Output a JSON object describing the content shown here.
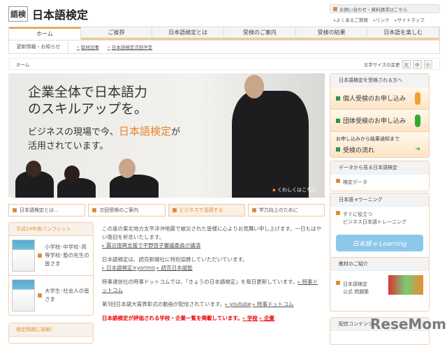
{
  "header": {
    "logo_mark": "語検",
    "title": "日本語検定",
    "contact": "お問い合わせ・資料請求はこちら",
    "links": [
      "よくあるご質問",
      "リンク",
      "サイトマップ"
    ]
  },
  "nav": {
    "tabs": [
      "ホーム",
      "ご挨拶",
      "日本語検定とは",
      "受検のご案内",
      "受検の結果",
      "日本語を楽しむ"
    ],
    "sub_label": "更新情報・お知らせ",
    "sub_links": [
      "取材記事",
      "日本語検定次回予定"
    ]
  },
  "breadcrumb": {
    "current": "ホーム",
    "font_size_label": "文字サイズの変更",
    "sizes": [
      "大",
      "中",
      "小"
    ]
  },
  "hero": {
    "line1": "企業全体で日本語力",
    "line2": "のスキルアップを。",
    "line3a": "ビジネスの現場で今、",
    "line3b": "日本語検定",
    "line3c": "が",
    "line4": "活用されています。",
    "more": "くわしくはこちら"
  },
  "subbuttons": [
    "日本語検定とは…",
    "次回受検のご案内",
    "ビジネスで活用する",
    "学力向上のために"
  ],
  "left": {
    "pamphlet_title": "平成24年度パンフレット",
    "items": [
      "小学校･中学校･高等学校･塾の先生の皆さま",
      "大学生･社会人の皆さま"
    ],
    "challenge_title": "検定問題に挑戦！"
  },
  "main": {
    "p1": "この度の東北地方太平洋沖地震で被災された皆様に心よりお見舞い申し上げます。一日もはやい復旧を祈念いたします。",
    "p1_link": "震災復興支援で平野啓子審議委員が講演",
    "p2": "日本語検定は、読売新聞社に特別協賛していただいています。",
    "p2_links": [
      "日本語検定×yorimo",
      "読売日本語塾"
    ],
    "p3": "時事通信社の時事ドットコムでは、「きょうの日本語検定」を毎日更新しています。",
    "p3_link": "時事ドットコム",
    "p4": "第3回日本語大賞表彰式の動画が配信されています。",
    "p4_links": [
      "youtube",
      "時事ドットコム"
    ],
    "p5": "日本語検定が評価される学校・企業一覧を掲載しています。",
    "p5_links": [
      "学校",
      "企業"
    ]
  },
  "right": {
    "apply_title": "日本語検定を受検される方へ",
    "individual": "個人受検のお申し込み",
    "group": "団体受検のお申し込み",
    "flow_note": "お申し込みから結果通知まで",
    "flow": "受検の流れ",
    "data_title": "データから見る日本語検定",
    "data_link": "検定データ",
    "el_title": "日本語 eラーニング",
    "el_line1": "すぐに役立つ",
    "el_line2": "ビジネス日本語トレーニング",
    "el_button": "日本語 e-Learning",
    "mat_title": "教材のご紹介",
    "mat_line1": "日本語検定",
    "mat_line2": "公式 問題集",
    "dist_title": "配信コンテンツ"
  },
  "watermark": "ReseMom"
}
